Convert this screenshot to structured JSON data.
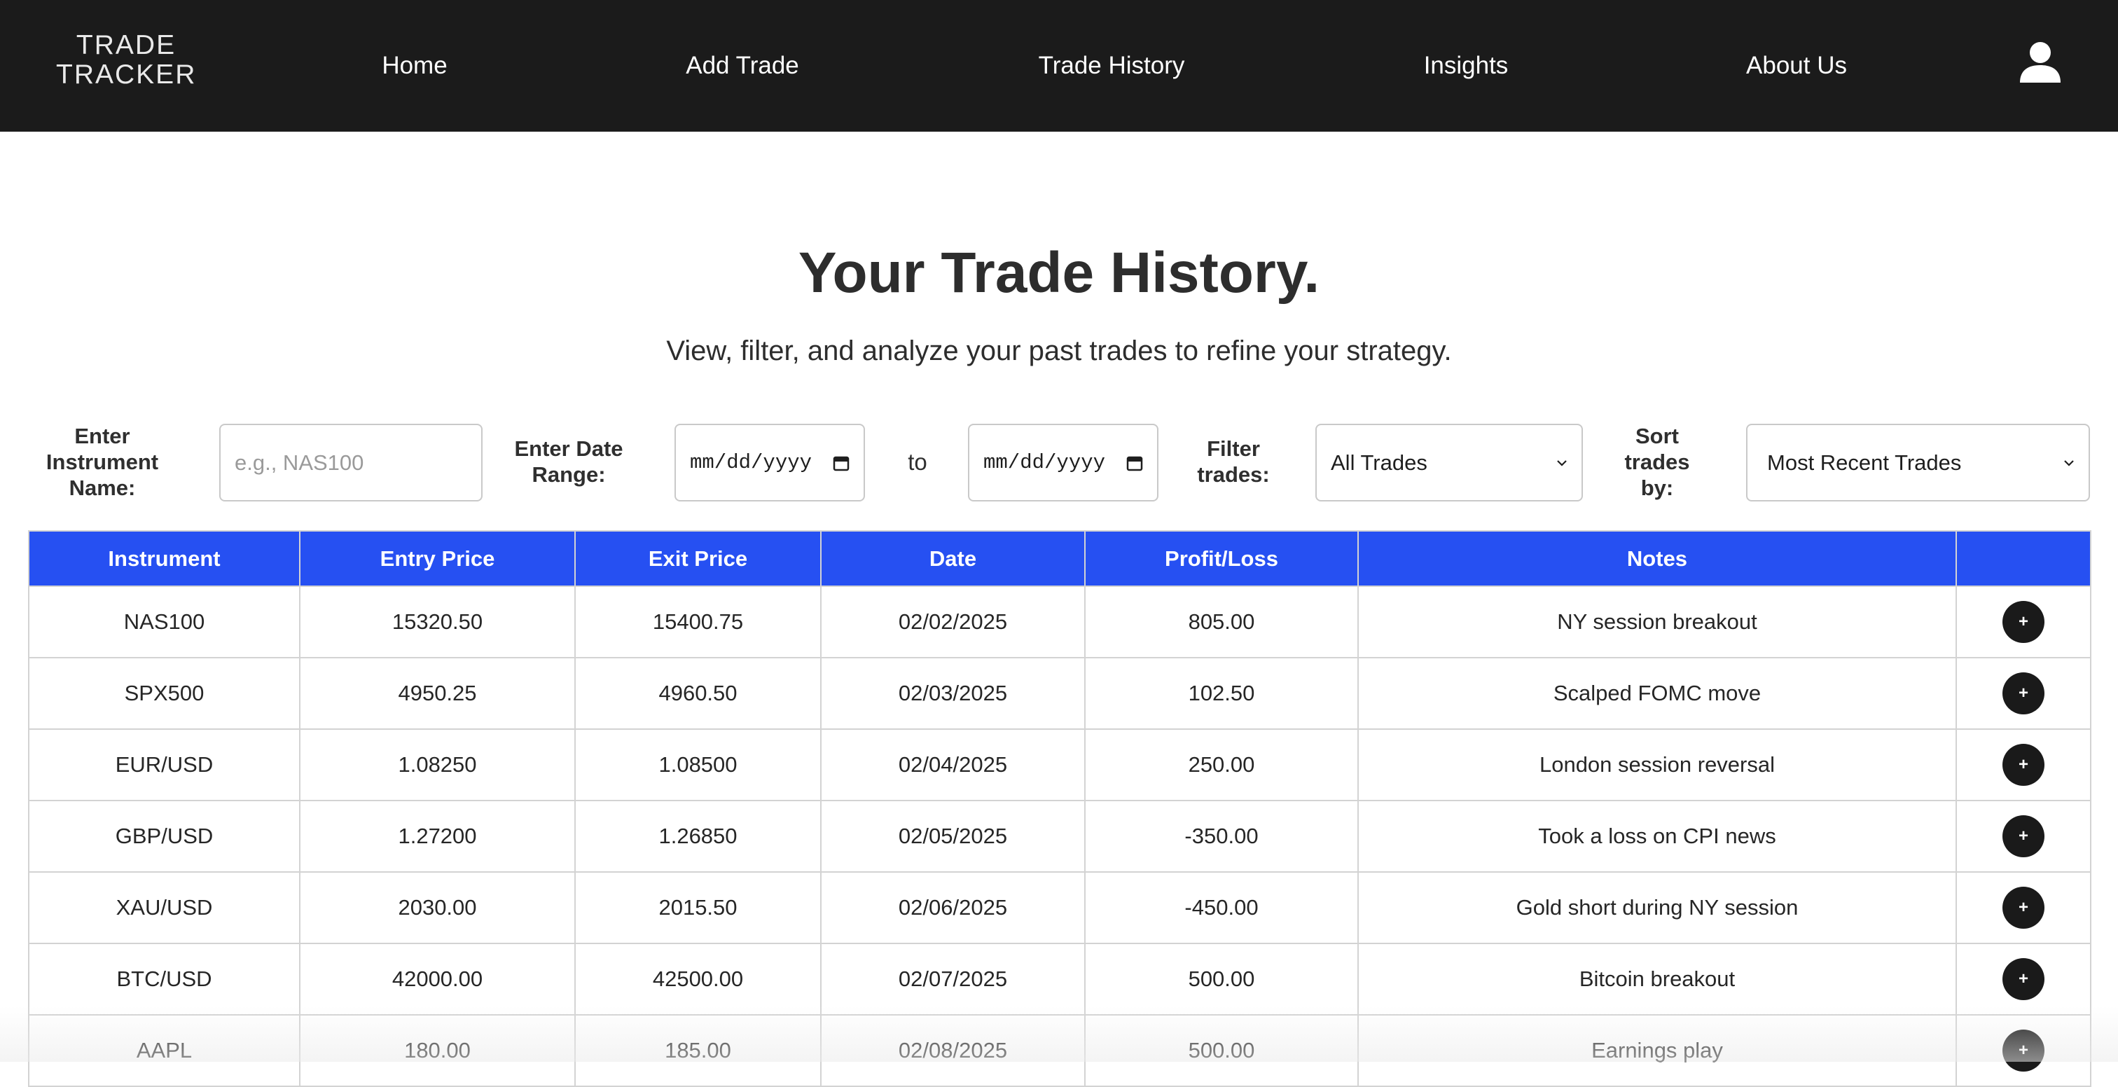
{
  "brand": {
    "line1": "TRADE",
    "line2": "TRACKER"
  },
  "nav": {
    "items": [
      {
        "label": "Home"
      },
      {
        "label": "Add Trade"
      },
      {
        "label": "Trade History"
      },
      {
        "label": "Insights"
      },
      {
        "label": "About Us"
      }
    ],
    "user_icon": "user-icon"
  },
  "header": {
    "title": "Your Trade History.",
    "subtitle": "View, filter, and analyze your past trades to refine your strategy."
  },
  "filters": {
    "instrument": {
      "label_line1": "Enter",
      "label_line2": "Instrument",
      "label_line3": "Name:",
      "placeholder": "e.g., NAS100",
      "value": ""
    },
    "date_range": {
      "label_line1": "Enter Date",
      "label_line2": "Range:",
      "from_placeholder": "mm/dd/yyyy",
      "to_label": "to",
      "to_placeholder": "mm/dd/yyyy"
    },
    "filter_trades": {
      "label_line1": "Filter",
      "label_line2": "trades:",
      "selected": "All Trades"
    },
    "sort": {
      "label_line1": "Sort",
      "label_line2": "trades",
      "label_line3": "by:",
      "selected": "Most Recent Trades"
    }
  },
  "table": {
    "headers": [
      "Instrument",
      "Entry Price",
      "Exit Price",
      "Date",
      "Profit/Loss",
      "Notes",
      ""
    ],
    "rows": [
      {
        "instrument": "NAS100",
        "entry": "15320.50",
        "exit": "15400.75",
        "date": "02/02/2025",
        "pl": "805.00",
        "notes": "NY session breakout",
        "action": "+"
      },
      {
        "instrument": "SPX500",
        "entry": "4950.25",
        "exit": "4960.50",
        "date": "02/03/2025",
        "pl": "102.50",
        "notes": "Scalped FOMC move",
        "action": "+"
      },
      {
        "instrument": "EUR/USD",
        "entry": "1.08250",
        "exit": "1.08500",
        "date": "02/04/2025",
        "pl": "250.00",
        "notes": "London session reversal",
        "action": "+"
      },
      {
        "instrument": "GBP/USD",
        "entry": "1.27200",
        "exit": "1.26850",
        "date": "02/05/2025",
        "pl": "-350.00",
        "notes": "Took a loss on CPI news",
        "action": "+"
      },
      {
        "instrument": "XAU/USD",
        "entry": "2030.00",
        "exit": "2015.50",
        "date": "02/06/2025",
        "pl": "-450.00",
        "notes": "Gold short during NY session",
        "action": "+"
      },
      {
        "instrument": "BTC/USD",
        "entry": "42000.00",
        "exit": "42500.00",
        "date": "02/07/2025",
        "pl": "500.00",
        "notes": "Bitcoin breakout",
        "action": "+"
      },
      {
        "instrument": "AAPL",
        "entry": "180.00",
        "exit": "185.00",
        "date": "02/08/2025",
        "pl": "500.00",
        "notes": "Earnings play",
        "action": "+"
      }
    ]
  },
  "colors": {
    "navbar_bg": "#1b1b1b",
    "table_header_bg": "#2650f2",
    "action_button_bg": "#1a1a1a"
  }
}
